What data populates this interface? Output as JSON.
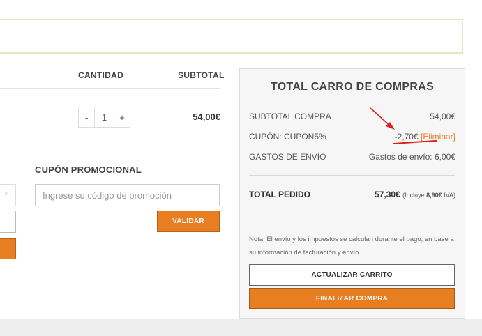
{
  "table": {
    "headers": {
      "quantity": "CANTIDAD",
      "subtotal": "SUBTOTAL"
    },
    "item": {
      "qty_minus": "-",
      "qty_value": "1",
      "qty_plus": "+",
      "subtotal": "54,00€"
    }
  },
  "coupon": {
    "title": "CUPÓN PROMOCIONAL",
    "placeholder": "Ingrese su código de promoción",
    "validate_label": "VALIDAR"
  },
  "left_fragment": {
    "select_glyph": "^"
  },
  "totals": {
    "title": "TOTAL CARRO DE COMPRAS",
    "rows": [
      {
        "label": "SUBTOTAL COMPRA",
        "value": "54,00€"
      },
      {
        "label": "CUPÓN: CUPON5%",
        "value": "-2,70€",
        "link": "[Eliminar]"
      },
      {
        "label": "GASTOS DE ENVÍO",
        "value": "Gastos de envío: 6,00€"
      }
    ],
    "total": {
      "label": "TOTAL PEDIDO",
      "value": "57,30€",
      "includes_prefix": "(Incluye",
      "tax_amount": "8,90€",
      "tax_suffix": "IVA)"
    },
    "note": "Nota: El envío y los impuestos se calculan durante el pago, en base a su información de facturación y envío.",
    "update_label": "ACTUALIZAR CARRITO",
    "checkout_label": "FINALIZAR COMPRA"
  },
  "colors": {
    "accent": "#e87e22",
    "annotation": "#e0201e",
    "notice_border": "#e0e9c3"
  },
  "icons": [
    "arrow-annotation-icon",
    "underline-annotation-icon",
    "chevron-up-icon"
  ]
}
